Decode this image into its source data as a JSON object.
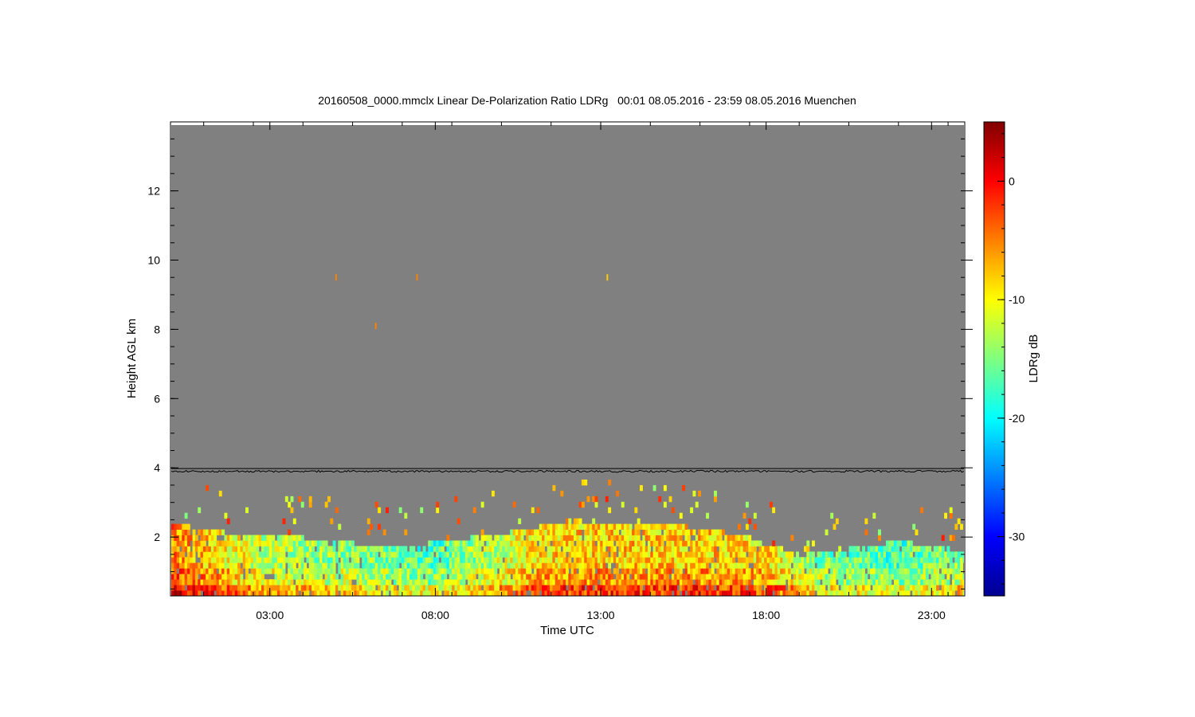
{
  "chart_data": {
    "type": "heatmap",
    "title": "20160508_0000.mmclx Linear De-Polarization Ratio LDRg   00:01 08.05.2016 - 23:59 08.05.2016 Muenchen",
    "xlabel": "Time UTC",
    "ylabel": "Height AGL km",
    "colorbar_label": "LDRg dB",
    "xlim_hours": [
      0.02,
      23.98
    ],
    "ylim_km": [
      0.3,
      13.9
    ],
    "x_ticks": [
      {
        "hour": 3,
        "label": "03:00"
      },
      {
        "hour": 8,
        "label": "08:00"
      },
      {
        "hour": 13,
        "label": "13:00"
      },
      {
        "hour": 18,
        "label": "18:00"
      },
      {
        "hour": 23,
        "label": "23:00"
      }
    ],
    "y_ticks": [
      {
        "km": 2,
        "label": "2"
      },
      {
        "km": 4,
        "label": "4"
      },
      {
        "km": 6,
        "label": "6"
      },
      {
        "km": 8,
        "label": "8"
      },
      {
        "km": 10,
        "label": "10"
      },
      {
        "km": 12,
        "label": "12"
      }
    ],
    "color_range_db": [
      -35,
      5
    ],
    "colorbar_ticks": [
      {
        "db": 0,
        "label": "0"
      },
      {
        "db": -10,
        "label": "-10"
      },
      {
        "db": -20,
        "label": "-20"
      },
      {
        "db": -30,
        "label": "-30"
      }
    ],
    "no_data_color": "#808080",
    "reference_line_km": 3.9,
    "signal_top_km": [
      {
        "hour": 0.0,
        "km": 2.3
      },
      {
        "hour": 2.0,
        "km": 2.0
      },
      {
        "hour": 4.0,
        "km": 1.9
      },
      {
        "hour": 6.0,
        "km": 1.7
      },
      {
        "hour": 7.5,
        "km": 1.7
      },
      {
        "hour": 9.0,
        "km": 1.9
      },
      {
        "hour": 10.5,
        "km": 2.1
      },
      {
        "hour": 12.0,
        "km": 2.4
      },
      {
        "hour": 14.0,
        "km": 2.3
      },
      {
        "hour": 16.0,
        "km": 2.2
      },
      {
        "hour": 17.5,
        "km": 1.9
      },
      {
        "hour": 19.0,
        "km": 1.4
      },
      {
        "hour": 20.5,
        "km": 1.6
      },
      {
        "hour": 22.0,
        "km": 1.8
      },
      {
        "hour": 24.0,
        "km": 1.5
      }
    ],
    "boundary_layer_ldr_db": [
      {
        "hour": 0.0,
        "db": -5
      },
      {
        "hour": 3.0,
        "db": -13
      },
      {
        "hour": 6.0,
        "db": -15
      },
      {
        "hour": 8.0,
        "db": -17
      },
      {
        "hour": 10.0,
        "db": -12
      },
      {
        "hour": 11.0,
        "db": -9
      },
      {
        "hour": 13.0,
        "db": -8
      },
      {
        "hour": 16.0,
        "db": -8
      },
      {
        "hour": 18.0,
        "db": -9
      },
      {
        "hour": 19.5,
        "db": -15
      },
      {
        "hour": 22.0,
        "db": -17
      },
      {
        "hour": 24.0,
        "db": -14
      }
    ],
    "isolated_points": [
      {
        "hour": 5.0,
        "km": 9.5,
        "db": -5
      },
      {
        "hour": 6.2,
        "km": 8.1,
        "db": -5
      },
      {
        "hour": 7.45,
        "km": 9.5,
        "db": -5
      },
      {
        "hour": 13.2,
        "km": 9.5,
        "db": -8
      }
    ]
  }
}
